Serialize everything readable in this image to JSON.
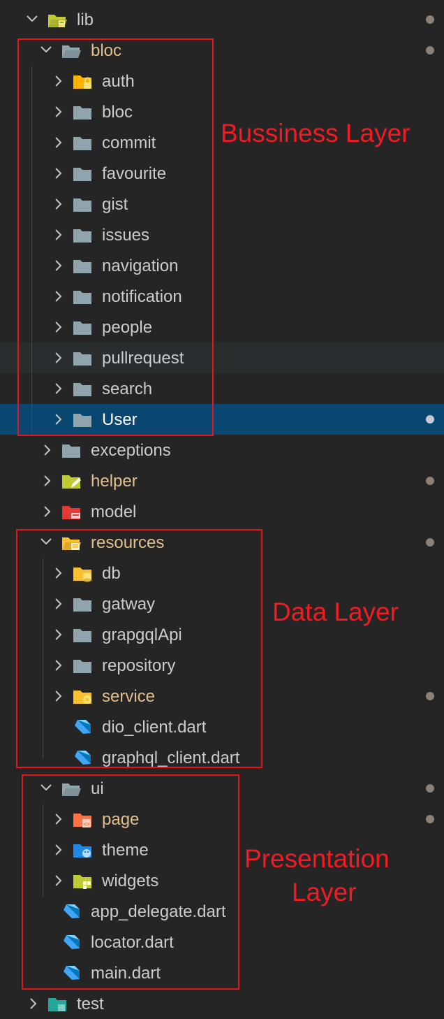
{
  "explorer": {
    "rows": [
      {
        "label": "lib",
        "depth": 0,
        "type": "folder",
        "expanded": true,
        "icon": "folder-lib-icon",
        "modified": false,
        "dot": true
      },
      {
        "label": "bloc",
        "depth": 1,
        "type": "folder",
        "expanded": true,
        "icon": "folder-open-icon",
        "modified": true,
        "dot": true
      },
      {
        "label": "auth",
        "depth": 2,
        "type": "folder",
        "expanded": false,
        "icon": "folder-auth-icon",
        "modified": false,
        "dot": false
      },
      {
        "label": "bloc",
        "depth": 2,
        "type": "folder",
        "expanded": false,
        "icon": "folder-icon",
        "modified": false,
        "dot": false
      },
      {
        "label": "commit",
        "depth": 2,
        "type": "folder",
        "expanded": false,
        "icon": "folder-icon",
        "modified": false,
        "dot": false
      },
      {
        "label": "favourite",
        "depth": 2,
        "type": "folder",
        "expanded": false,
        "icon": "folder-icon",
        "modified": false,
        "dot": false
      },
      {
        "label": "gist",
        "depth": 2,
        "type": "folder",
        "expanded": false,
        "icon": "folder-icon",
        "modified": false,
        "dot": false
      },
      {
        "label": "issues",
        "depth": 2,
        "type": "folder",
        "expanded": false,
        "icon": "folder-icon",
        "modified": false,
        "dot": false
      },
      {
        "label": "navigation",
        "depth": 2,
        "type": "folder",
        "expanded": false,
        "icon": "folder-icon",
        "modified": false,
        "dot": false
      },
      {
        "label": "notification",
        "depth": 2,
        "type": "folder",
        "expanded": false,
        "icon": "folder-icon",
        "modified": false,
        "dot": false
      },
      {
        "label": "people",
        "depth": 2,
        "type": "folder",
        "expanded": false,
        "icon": "folder-icon",
        "modified": false,
        "dot": false
      },
      {
        "label": "pullrequest",
        "depth": 2,
        "type": "folder",
        "expanded": false,
        "icon": "folder-icon",
        "modified": false,
        "dot": false,
        "hover": true
      },
      {
        "label": "search",
        "depth": 2,
        "type": "folder",
        "expanded": false,
        "icon": "folder-icon",
        "modified": false,
        "dot": false
      },
      {
        "label": "User",
        "depth": 2,
        "type": "folder",
        "expanded": false,
        "icon": "folder-icon",
        "modified": false,
        "dot": true,
        "selected": true
      },
      {
        "label": "exceptions",
        "depth": 1,
        "type": "folder",
        "expanded": false,
        "icon": "folder-icon",
        "modified": false,
        "dot": false
      },
      {
        "label": "helper",
        "depth": 1,
        "type": "folder",
        "expanded": false,
        "icon": "folder-helper-icon",
        "modified": true,
        "dot": true
      },
      {
        "label": "model",
        "depth": 1,
        "type": "folder",
        "expanded": false,
        "icon": "folder-model-icon",
        "modified": false,
        "dot": false
      },
      {
        "label": "resources",
        "depth": 1,
        "type": "folder",
        "expanded": true,
        "icon": "folder-resources-icon",
        "modified": true,
        "dot": true
      },
      {
        "label": "db",
        "depth": 2,
        "type": "folder",
        "expanded": false,
        "icon": "folder-db-icon",
        "modified": false,
        "dot": false
      },
      {
        "label": "gatway",
        "depth": 2,
        "type": "folder",
        "expanded": false,
        "icon": "folder-icon",
        "modified": false,
        "dot": false
      },
      {
        "label": "grapgqlApi",
        "depth": 2,
        "type": "folder",
        "expanded": false,
        "icon": "folder-icon",
        "modified": false,
        "dot": false
      },
      {
        "label": "repository",
        "depth": 2,
        "type": "folder",
        "expanded": false,
        "icon": "folder-icon",
        "modified": false,
        "dot": false
      },
      {
        "label": "service",
        "depth": 2,
        "type": "folder",
        "expanded": false,
        "icon": "folder-service-icon",
        "modified": true,
        "dot": true
      },
      {
        "label": "dio_client.dart",
        "depth": 2,
        "type": "file",
        "icon": "dart-file-icon",
        "modified": false,
        "dot": false
      },
      {
        "label": "graphql_client.dart",
        "depth": 2,
        "type": "file",
        "icon": "dart-file-icon",
        "modified": false,
        "dot": false
      },
      {
        "label": "ui",
        "depth": 1,
        "type": "folder",
        "expanded": true,
        "icon": "folder-open-icon",
        "modified": false,
        "dot": true
      },
      {
        "label": "page",
        "depth": 2,
        "type": "folder",
        "expanded": false,
        "icon": "folder-page-icon",
        "modified": true,
        "dot": true
      },
      {
        "label": "theme",
        "depth": 2,
        "type": "folder",
        "expanded": false,
        "icon": "folder-theme-icon",
        "modified": false,
        "dot": false
      },
      {
        "label": "widgets",
        "depth": 2,
        "type": "folder",
        "expanded": false,
        "icon": "folder-widgets-icon",
        "modified": false,
        "dot": false
      },
      {
        "label": "app_delegate.dart",
        "depth": 1,
        "type": "file",
        "icon": "dart-file-icon",
        "modified": false,
        "dot": false
      },
      {
        "label": "locator.dart",
        "depth": 1,
        "type": "file",
        "icon": "dart-file-icon",
        "modified": false,
        "dot": false
      },
      {
        "label": "main.dart",
        "depth": 1,
        "type": "file",
        "icon": "dart-file-icon",
        "modified": false,
        "dot": false
      },
      {
        "label": "test",
        "depth": 0,
        "type": "folder",
        "expanded": false,
        "icon": "folder-test-icon",
        "modified": false,
        "dot": false
      }
    ]
  },
  "annotations": {
    "business": "Bussiness Layer",
    "data": "Data Layer",
    "presentation_line1": "Presentation",
    "presentation_line2": "Layer"
  },
  "colors": {
    "background": "#252526",
    "selected": "#094771",
    "hover": "#2a2d2e",
    "text": "#cccccc",
    "modified_text": "#e2c08d",
    "annotation_red": "#e8141c",
    "folder_grey": "#90a4ae",
    "dart_blue": "#42a5f5"
  }
}
